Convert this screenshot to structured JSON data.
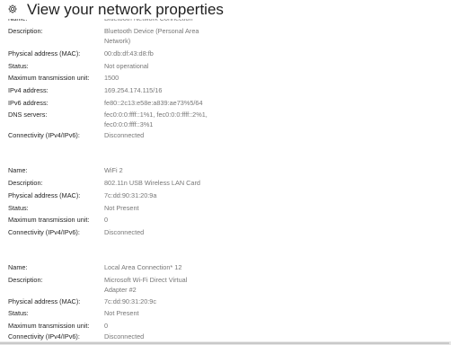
{
  "header": {
    "title": "View your network properties",
    "icon": "gear-icon"
  },
  "adapters": [
    {
      "name_label": "Name:",
      "name_value": "Bluetooth Network Connection",
      "description_label": "Description:",
      "description_lines": [
        "Bluetooth Device (Personal Area",
        "Network)"
      ],
      "mac_label": "Physical address (MAC):",
      "mac_value": "00:db:df:43:d8:fb",
      "status_label": "Status:",
      "status_value": "Not operational",
      "mtu_label": "Maximum transmission unit:",
      "mtu_value": "1500",
      "ipv4_label": "IPv4 address:",
      "ipv4_value": "169.254.174.115/16",
      "ipv6_label": "IPv6 address:",
      "ipv6_value": "fe80::2c13:e58e:a839:ae73%5/64",
      "dns_label": "DNS servers:",
      "dns_lines": [
        "fec0:0:0:ffff::1%1, fec0:0:0:ffff::2%1,",
        "fec0:0:0:ffff::3%1"
      ],
      "connectivity_label": "Connectivity (IPv4/IPv6):",
      "connectivity_value": "Disconnected"
    },
    {
      "name_label": "Name:",
      "name_value": "WiFi 2",
      "description_label": "Description:",
      "description_lines": [
        "802.11n USB Wireless LAN Card"
      ],
      "mac_label": "Physical address (MAC):",
      "mac_value": "7c:dd:90:31:20:9a",
      "status_label": "Status:",
      "status_value": "Not Present",
      "mtu_label": "Maximum transmission unit:",
      "mtu_value": "0",
      "connectivity_label": "Connectivity (IPv4/IPv6):",
      "connectivity_value": "Disconnected"
    },
    {
      "name_label": "Name:",
      "name_value": "Local Area Connection* 12",
      "description_label": "Description:",
      "description_lines": [
        "Microsoft Wi-Fi Direct Virtual",
        "Adapter #2"
      ],
      "mac_label": "Physical address (MAC):",
      "mac_value": "7c:dd:90:31:20:9c",
      "status_label": "Status:",
      "status_value": "Not Present",
      "mtu_label": "Maximum transmission unit:",
      "mtu_value": "0",
      "connectivity_label": "Connectivity (IPv4/IPv6):",
      "connectivity_value": "Disconnected"
    }
  ]
}
